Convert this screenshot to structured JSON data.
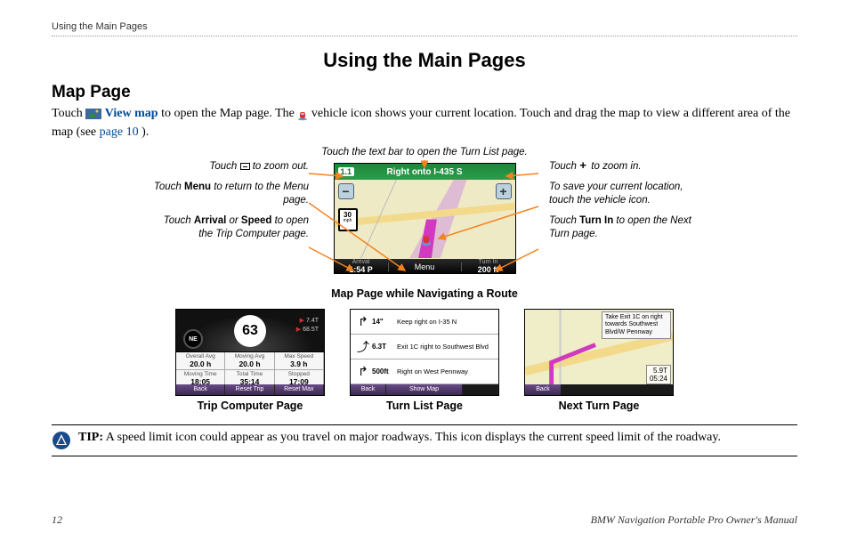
{
  "running_header": "Using the Main Pages",
  "page_title": "Using the Main Pages",
  "section_heading": "Map Page",
  "para": {
    "t1": "Touch ",
    "view_map": "View map",
    "t2": " to open the Map page. The ",
    "t3": " vehicle icon shows your current location. Touch and drag the map to view a different area of the map (see ",
    "page_link": "page 10",
    "t4": ")."
  },
  "diagram": {
    "caption_top": "Touch the text bar to open the Turn List page.",
    "caption_bottom": "Map Page while Navigating a Route",
    "left": {
      "zoom_out_a": "Touch ",
      "zoom_out_b": " to zoom out.",
      "menu_a": "Touch ",
      "menu_b": "Menu",
      "menu_c": " to return to the Menu page.",
      "arrival_a": "Touch ",
      "arrival_b": "Arrival",
      "arrival_c": " or ",
      "arrival_d": "Speed",
      "arrival_e": " to open the Trip Computer page."
    },
    "right": {
      "zoom_in_a": "Touch ",
      "zoom_in_b": " to zoom in.",
      "save_loc": "To save your current location, touch the vehicle icon.",
      "turnin_a": "Touch ",
      "turnin_b": "Turn In",
      "turnin_c": " to open the Next Turn page."
    },
    "device": {
      "top_num": "1.1",
      "top_text": "Right onto I-435 S",
      "speed_limit": "30",
      "speed_unit": "mph",
      "arrival_label": "Arrival",
      "arrival_val": "1:54 P",
      "menu_label": "Menu",
      "turnin_label": "Turn In",
      "turnin_val": "200 ft"
    }
  },
  "thumbs": {
    "trip_computer": {
      "caption": "Trip Computer Page",
      "compass": "NE",
      "speed": "63",
      "side1": "7.4T",
      "side2": "68.5T",
      "cells": [
        {
          "lbl": "Overall Avg",
          "val": "20.0 h"
        },
        {
          "lbl": "Moving Avg",
          "val": "20.0 h"
        },
        {
          "lbl": "Max Speed",
          "val": "3.9 h"
        },
        {
          "lbl": "Moving Time",
          "val": "18:05"
        },
        {
          "lbl": "Total Time",
          "val": "35:14"
        },
        {
          "lbl": "Stopped",
          "val": "17:09"
        }
      ],
      "bar": [
        "Back",
        "Reset Trip",
        "Reset Max"
      ]
    },
    "turn_list": {
      "caption": "Turn List Page",
      "rows": [
        {
          "dist": "14\"",
          "text": "Keep right on I-35 N"
        },
        {
          "dist": "6.3T",
          "text": "Exit 1C right to Southwest Blvd"
        },
        {
          "dist": "500ft",
          "text": "Right on West Pennway"
        }
      ],
      "bar_back": "Back",
      "bar_show": "Show Map"
    },
    "next_turn": {
      "caption": "Next Turn Page",
      "banner": "Take Exit 1C on right towards Southwest Blvd/W Pennway",
      "dist": "5.9T",
      "time": "05:24",
      "bar_back": "Back"
    }
  },
  "tip": {
    "label": "TIP:",
    "text": " A speed limit icon could appear as you travel on major roadways. This icon displays the current speed limit of the roadway."
  },
  "footer": {
    "page_no": "12",
    "doc_title": "BMW Navigation Portable Pro Owner's Manual"
  }
}
